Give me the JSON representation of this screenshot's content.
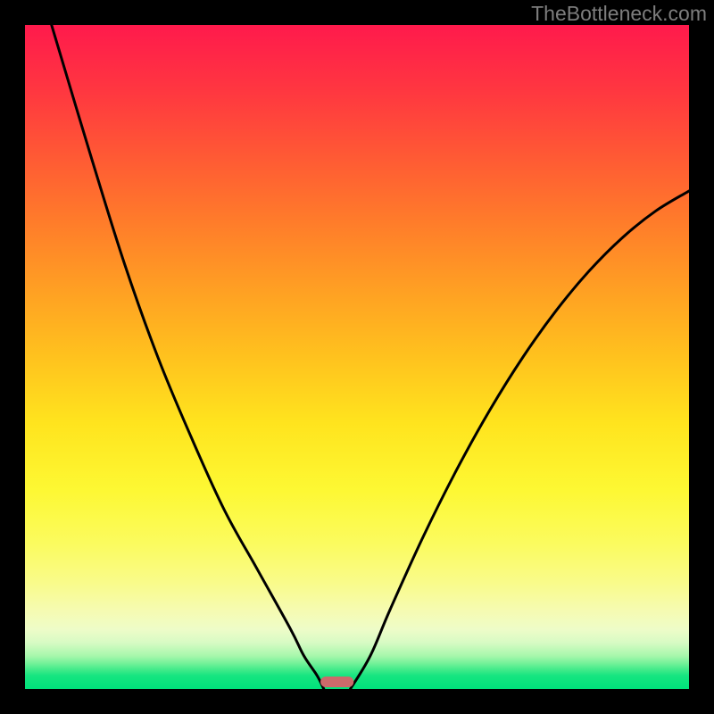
{
  "watermark": "TheBottleneck.com",
  "chart_data": {
    "type": "line",
    "title": "",
    "xlabel": "",
    "ylabel": "",
    "xlim": [
      0,
      100
    ],
    "ylim": [
      0,
      100
    ],
    "series": [
      {
        "name": "left-curve",
        "x": [
          4,
          10,
          15,
          20,
          25,
          30,
          35,
          40,
          42,
          44,
          45
        ],
        "values": [
          100,
          80,
          64,
          50,
          38,
          27,
          18,
          9,
          5,
          2,
          0
        ]
      },
      {
        "name": "right-curve",
        "x": [
          49,
          52,
          55,
          60,
          65,
          70,
          75,
          80,
          85,
          90,
          95,
          100
        ],
        "values": [
          0,
          5,
          12,
          23,
          33,
          42,
          50,
          57,
          63,
          68,
          72,
          75
        ]
      }
    ],
    "marker": {
      "x": 47,
      "width": 5,
      "color": "#cc6a6b"
    },
    "gradient_bands": [
      {
        "y": 0,
        "color": "#ff1a4c"
      },
      {
        "y": 10,
        "color": "#ff3740"
      },
      {
        "y": 20,
        "color": "#ff5a34"
      },
      {
        "y": 30,
        "color": "#ff7d2a"
      },
      {
        "y": 40,
        "color": "#ffa023"
      },
      {
        "y": 50,
        "color": "#ffc21e"
      },
      {
        "y": 60,
        "color": "#ffe41e"
      },
      {
        "y": 70,
        "color": "#fdf833"
      },
      {
        "y": 78,
        "color": "#fbfb5e"
      },
      {
        "y": 84,
        "color": "#f9fb8a"
      },
      {
        "y": 88,
        "color": "#f6fbb0"
      },
      {
        "y": 91,
        "color": "#eefcc8"
      },
      {
        "y": 93,
        "color": "#d8fbc4"
      },
      {
        "y": 95,
        "color": "#a7f7ac"
      },
      {
        "y": 96,
        "color": "#7af29b"
      },
      {
        "y": 97,
        "color": "#46eb8b"
      },
      {
        "y": 98,
        "color": "#16e580"
      },
      {
        "y": 100,
        "color": "#00e27b"
      }
    ]
  }
}
